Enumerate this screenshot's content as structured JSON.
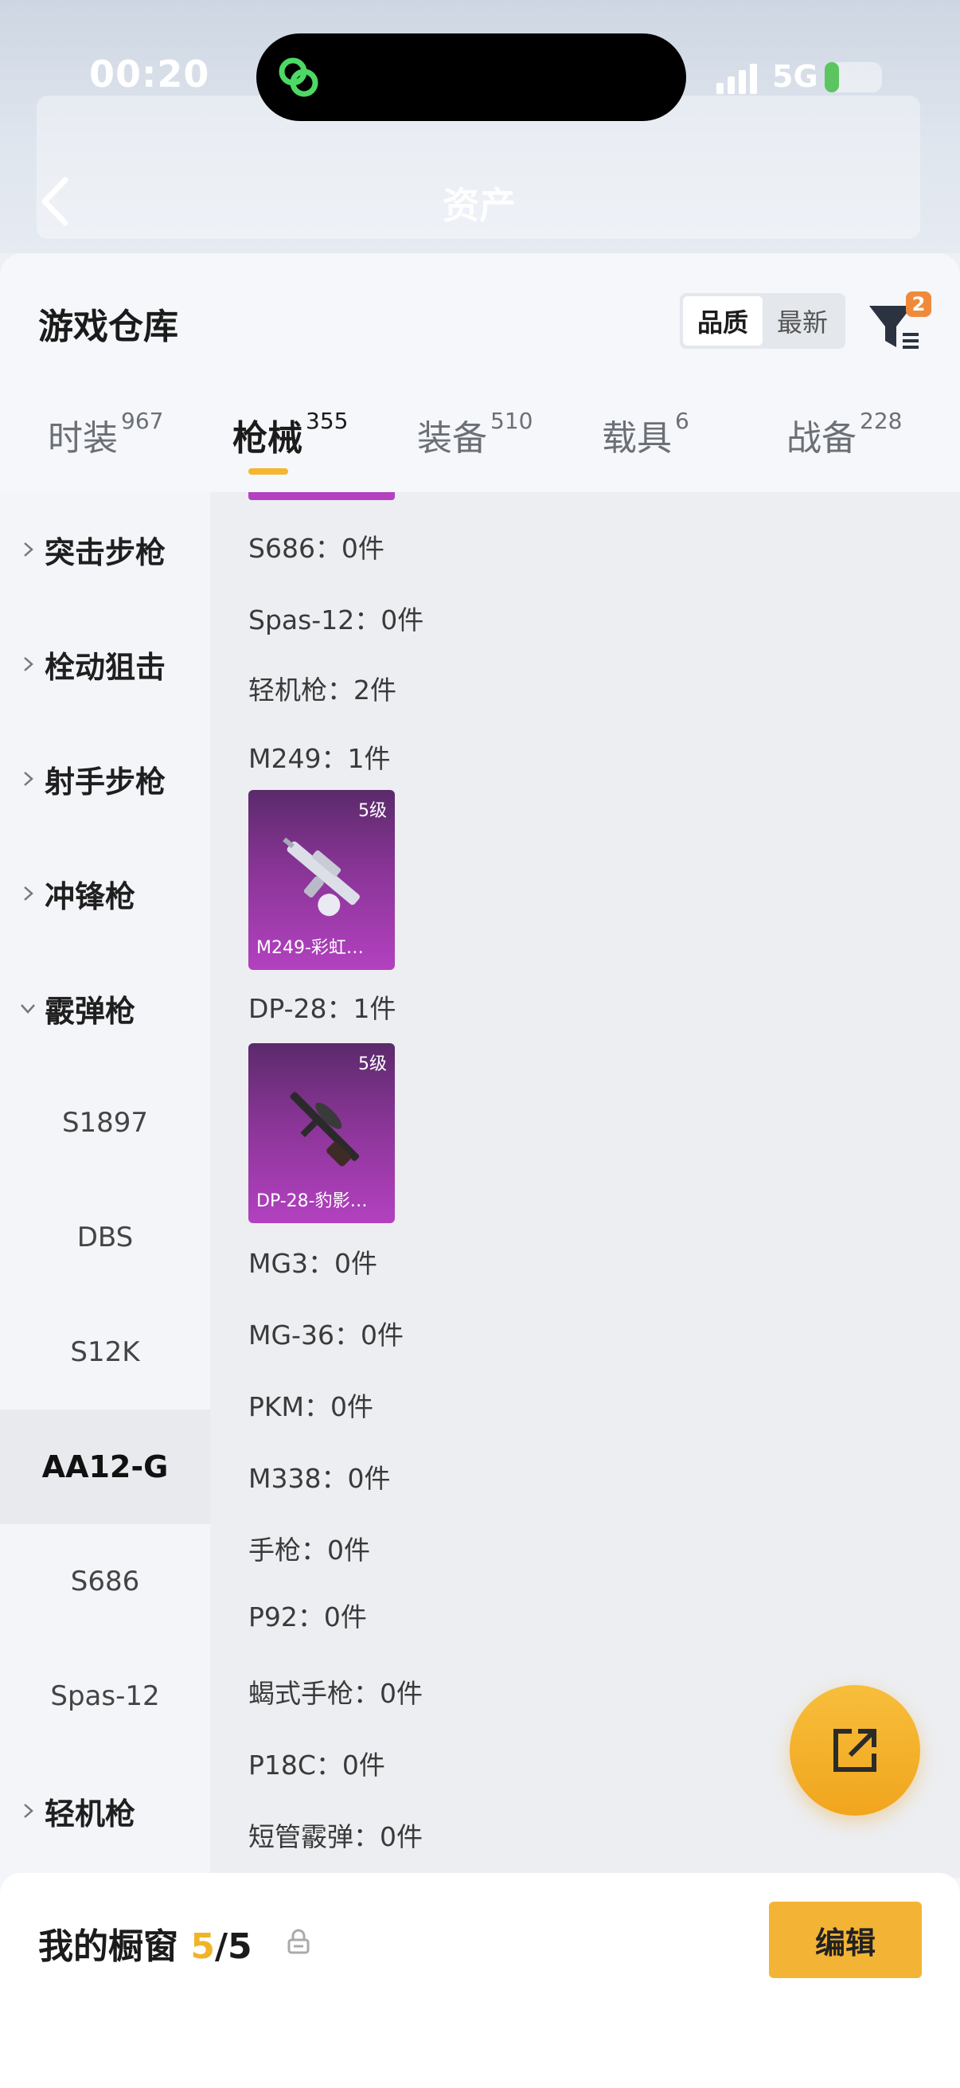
{
  "status": {
    "time": "00:20",
    "network": "5G"
  },
  "header": {
    "title": "资产"
  },
  "sheet": {
    "title": "游戏仓库",
    "sort": {
      "quality": "品质",
      "latest": "最新"
    },
    "filter_badge": "2"
  },
  "tabs": [
    {
      "label": "时装",
      "count": "967"
    },
    {
      "label": "枪械",
      "count": "355"
    },
    {
      "label": "装备",
      "count": "510"
    },
    {
      "label": "载具",
      "count": "6"
    },
    {
      "label": "战备",
      "count": "228"
    }
  ],
  "categories": {
    "assault": "突击步枪",
    "bolt": "栓动狙击",
    "dmr": "射手步枪",
    "smg": "冲锋枪",
    "shotgun": "霰弹枪",
    "s1897": "S1897",
    "dbs": "DBS",
    "s12k": "S12K",
    "aa12": "AA12-G",
    "s686": "S686",
    "spas": "Spas-12",
    "lmg": "轻机枪"
  },
  "items": [
    "S686：0件",
    "Spas-12：0件",
    "轻机枪：2件",
    "M249：1件",
    "DP-28：1件",
    "MG3：0件",
    "MG-36：0件",
    "PKM：0件",
    "M338：0件",
    "手枪：0件",
    "P92：0件",
    "蝎式手枪：0件",
    "P18C：0件",
    "短管霰弹：0件"
  ],
  "cards": [
    {
      "level": "5级",
      "name": "M249-彩虹…"
    },
    {
      "level": "5级",
      "name": "DP-28-豹影…"
    }
  ],
  "bottom": {
    "title": "我的橱窗",
    "current": "5",
    "total": "/5",
    "edit": "编辑"
  },
  "colors": {
    "accent": "#f3b436",
    "purple": "#b341c0"
  }
}
